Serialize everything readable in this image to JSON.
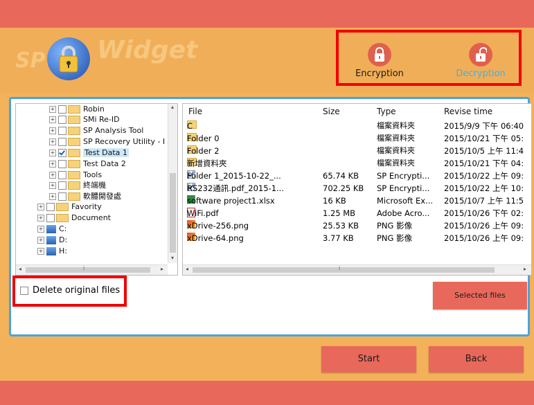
{
  "logo": {
    "text_sp": "SP",
    "text_widget": "Widget",
    "icon": "padlock-globe-icon"
  },
  "modes": {
    "encryption": {
      "label": "Encryption",
      "icon": "locked-padlock-icon",
      "color": "#1a1a1a"
    },
    "decryption": {
      "label": "Decryption",
      "icon": "unlocked-padlock-icon",
      "color": "#39b3f0"
    }
  },
  "tree": {
    "items": [
      {
        "label": "Robin",
        "checked": false,
        "icon": "folder-icon"
      },
      {
        "label": "SMi Re-ID",
        "checked": false,
        "icon": "folder-icon"
      },
      {
        "label": "SP Analysis Tool",
        "checked": false,
        "icon": "folder-icon"
      },
      {
        "label": "SP Recovery Utility - I",
        "checked": false,
        "icon": "folder-icon"
      },
      {
        "label": "Test Data 1",
        "checked": true,
        "icon": "folder-icon"
      },
      {
        "label": "Test Data 2",
        "checked": false,
        "icon": "folder-icon"
      },
      {
        "label": "Tools",
        "checked": false,
        "icon": "folder-icon"
      },
      {
        "label": "終端機",
        "checked": false,
        "icon": "folder-icon"
      },
      {
        "label": "軟體開發處",
        "checked": false,
        "icon": "folder-icon"
      },
      {
        "label": "Favority",
        "checked": false,
        "icon": "folder-icon"
      },
      {
        "label": "Document",
        "checked": false,
        "icon": "folder-icon"
      },
      {
        "label": "C:",
        "checked": false,
        "icon": "drive-icon"
      },
      {
        "label": "D:",
        "checked": false,
        "icon": "drive-icon"
      },
      {
        "label": "H:",
        "checked": false,
        "icon": "drive-icon"
      }
    ]
  },
  "filelist": {
    "columns": [
      "File",
      "Size",
      "Type",
      "Revise time"
    ],
    "rows": [
      {
        "file": "C",
        "size": "",
        "type": "檔案資料夾",
        "time": "2015/9/9 下午 06:40",
        "icon": "folder-icon"
      },
      {
        "file": "Folder 0",
        "size": "",
        "type": "檔案資料夾",
        "time": "2015/10/21 下午 05:",
        "icon": "folder-icon"
      },
      {
        "file": "Folder 2",
        "size": "",
        "type": "檔案資料夾",
        "time": "2015/10/5 上午 11:4",
        "icon": "folder-icon"
      },
      {
        "file": "新增資料夾",
        "size": "",
        "type": "檔案資料夾",
        "time": "2015/10/21 下午 04:",
        "icon": "folder-icon"
      },
      {
        "file": "Folder 1_2015-10-22_...",
        "size": "65.74 KB",
        "type": "SP Encrypti...",
        "time": "2015/10/22 上午 09:",
        "icon": "encrypted-file-icon"
      },
      {
        "file": "RS232通訊.pdf_2015-1...",
        "size": "702.25 KB",
        "type": "SP Encrypti...",
        "time": "2015/10/22 上午 10:",
        "icon": "encrypted-file-icon"
      },
      {
        "file": "software project1.xlsx",
        "size": "16 KB",
        "type": "Microsoft Ex...",
        "time": "2015/10/7 上午 11:5",
        "icon": "excel-file-icon"
      },
      {
        "file": "WiFi.pdf",
        "size": "1.25 MB",
        "type": "Adobe Acro...",
        "time": "2015/10/26 下午 02:",
        "icon": "pdf-file-icon"
      },
      {
        "file": "xDrive-256.png",
        "size": "25.53 KB",
        "type": "PNG 影像",
        "time": "2015/10/26 上午 09:",
        "icon": "image-file-icon"
      },
      {
        "file": "xDrive-64.png",
        "size": "3.77 KB",
        "type": "PNG 影像",
        "time": "2015/10/26 上午 09:",
        "icon": "image-file-icon"
      }
    ]
  },
  "options": {
    "delete_original_label": "Delete original files",
    "delete_original_checked": false
  },
  "buttons": {
    "selected_files": "Selected files",
    "start": "Start",
    "back": "Back"
  },
  "scroll_glyphs": {
    "left": "◂",
    "right": "▸",
    "up": "▴",
    "down": "▾",
    "grip": "⁞"
  },
  "colors": {
    "accent_red": "#e8695b",
    "background_orange": "#f3b25a",
    "panel_border_blue": "#4aa3df",
    "highlight_red": "#f00000"
  }
}
